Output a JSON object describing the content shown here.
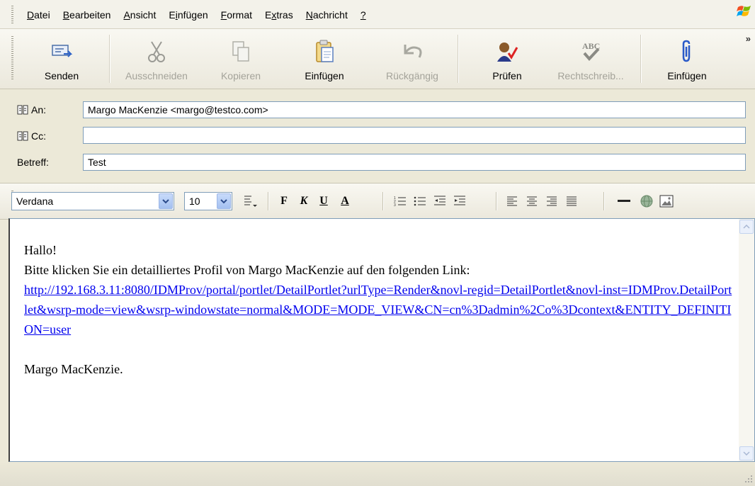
{
  "menu": {
    "items": [
      {
        "pre": "",
        "key": "D",
        "post": "atei"
      },
      {
        "pre": "",
        "key": "B",
        "post": "earbeiten"
      },
      {
        "pre": "",
        "key": "A",
        "post": "nsicht"
      },
      {
        "pre": "E",
        "key": "i",
        "post": "nfügen"
      },
      {
        "pre": "",
        "key": "F",
        "post": "ormat"
      },
      {
        "pre": "E",
        "key": "x",
        "post": "tras"
      },
      {
        "pre": "",
        "key": "N",
        "post": "achricht"
      },
      {
        "pre": "",
        "key": "?",
        "post": ""
      }
    ]
  },
  "toolbar": {
    "send": "Senden",
    "cut": "Ausschneiden",
    "copy": "Kopieren",
    "paste": "Einfügen",
    "undo": "Rückgängig",
    "check": "Prüfen",
    "spelling": "Rechtschreib...",
    "attach": "Einfügen",
    "overflow": "»"
  },
  "address": {
    "to_label": "An:",
    "to_value": "Margo MacKenzie <margo@testco.com>",
    "cc_label": "Cc:",
    "cc_value": "",
    "subject_label": "Betreff:",
    "subject_value": "Test"
  },
  "format": {
    "font": "Verdana",
    "size": "10",
    "bold": "F",
    "italic": "K",
    "underline": "U",
    "fontcolor": "A"
  },
  "body": {
    "greeting": "Hallo!",
    "line1": "Bitte klicken Sie ein detailliertes Profil von Margo MacKenzie auf den folgenden Link:",
    "link": "http://192.168.3.11:8080/IDMProv/portal/portlet/DetailPortlet?urlType=Render&novl-regid=DetailPortlet&novl-inst=IDMProv.DetailPortlet&wsrp-mode=view&wsrp-windowstate=normal&MODE=MODE_VIEW&CN=cn%3Dadmin%2Co%3Dcontext&ENTITY_DEFINITION=user",
    "signature": "Margo MacKenzie."
  },
  "colors": {
    "link": "#0000ee",
    "field_border": "#7f9db9",
    "chrome": "#ece9d8"
  }
}
